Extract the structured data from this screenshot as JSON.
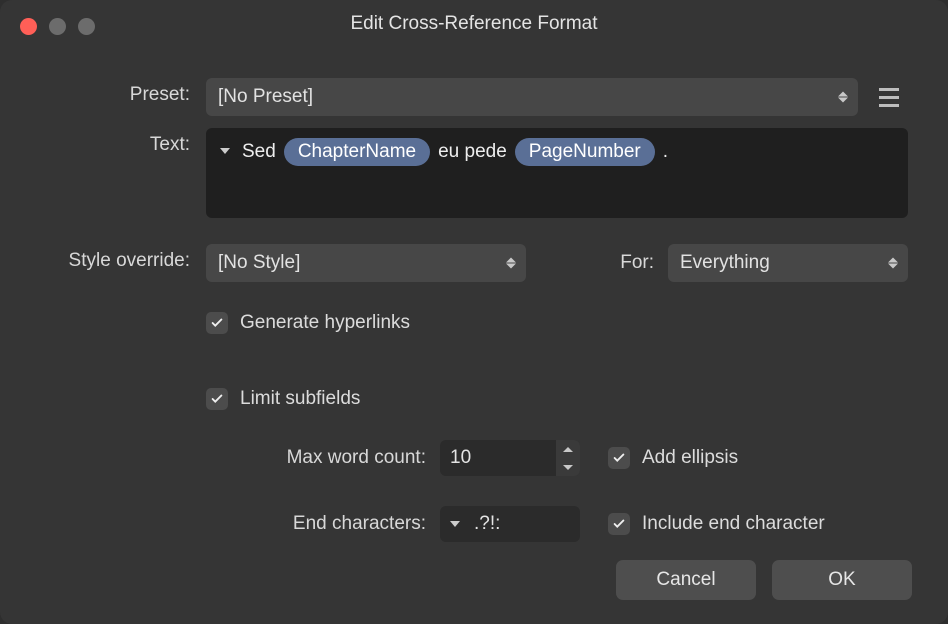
{
  "window": {
    "title": "Edit Cross-Reference Format"
  },
  "labels": {
    "preset": "Preset:",
    "text": "Text:",
    "style_override": "Style override:",
    "for": "For:",
    "max_word_count": "Max word count:",
    "end_characters": "End characters:"
  },
  "preset": {
    "value": "[No Preset]"
  },
  "text_field": {
    "seg1": "Sed",
    "pill1": "ChapterName",
    "seg2": "eu pede",
    "pill2": "PageNumber",
    "seg3": "."
  },
  "style_override": {
    "value": "[No Style]"
  },
  "for_select": {
    "value": "Everything"
  },
  "checkboxes": {
    "generate_hyperlinks": "Generate hyperlinks",
    "limit_subfields": "Limit subfields",
    "add_ellipsis": "Add ellipsis",
    "include_end_char": "Include end character"
  },
  "max_word_count": {
    "value": "10"
  },
  "end_characters": {
    "value": ".?!:"
  },
  "buttons": {
    "cancel": "Cancel",
    "ok": "OK"
  }
}
